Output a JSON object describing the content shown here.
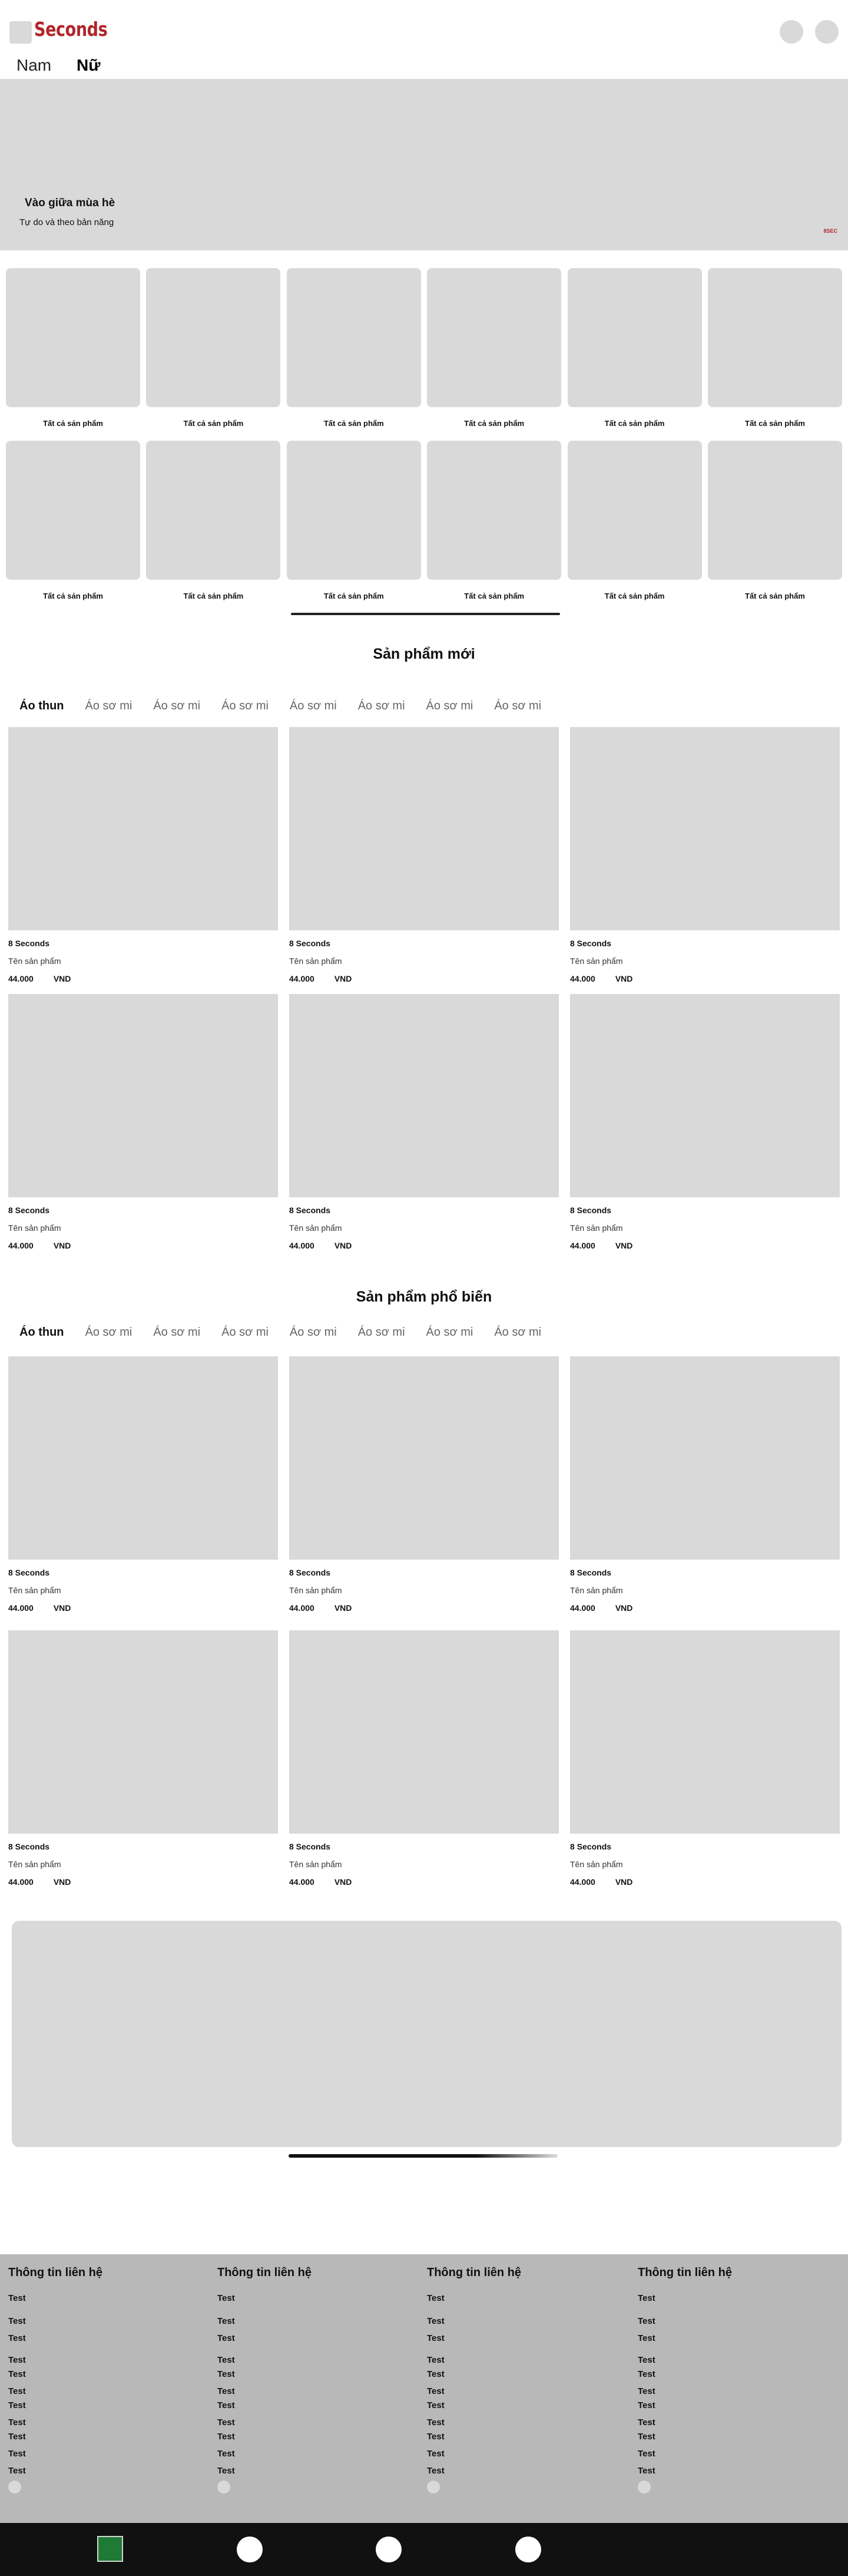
{
  "header": {
    "logo_text": "Seconds",
    "genders": [
      "Nam",
      "Nữ"
    ]
  },
  "hero": {
    "title": "Vào giữa mùa hè",
    "subtitle": "Tự do và theo bản năng",
    "brand_mark": "8SEC"
  },
  "categories": [
    "Tất cả sản phẩm",
    "Tất cả sản phẩm",
    "Tất cả sản phẩm",
    "Tất cả sản phẩm",
    "Tất cả sản phẩm",
    "Tất cả sản phẩm",
    "Tất cả sản phẩm",
    "Tất cả sản phẩm",
    "Tất cả sản phẩm",
    "Tất cả sản phẩm",
    "Tất cả sản phẩm",
    "Tất cả sản phẩm"
  ],
  "new_products": {
    "title": "Sản phẩm mới",
    "tabs": [
      "Áo thun",
      "Áo sơ mi",
      "Áo sơ mi",
      "Áo sơ mi",
      "Áo sơ mi",
      "Áo sơ mi",
      "Áo sơ mi",
      "Áo sơ mi"
    ],
    "products": [
      {
        "brand": "8 Seconds",
        "name": "Tên sản phẩm",
        "price": "44.000",
        "currency": "VND"
      },
      {
        "brand": "8 Seconds",
        "name": "Tên sản phẩm",
        "price": "44.000",
        "currency": "VND"
      },
      {
        "brand": "8 Seconds",
        "name": "Tên sản phẩm",
        "price": "44.000",
        "currency": "VND"
      },
      {
        "brand": "8 Seconds",
        "name": "Tên sản phẩm",
        "price": "44.000",
        "currency": "VND"
      },
      {
        "brand": "8 Seconds",
        "name": "Tên sản phẩm",
        "price": "44.000",
        "currency": "VND"
      },
      {
        "brand": "8 Seconds",
        "name": "Tên sản phẩm",
        "price": "44.000",
        "currency": "VND"
      }
    ]
  },
  "popular_products": {
    "title": "Sản phẩm phổ biến",
    "tabs": [
      "Áo thun",
      "Áo sơ mi",
      "Áo sơ mi",
      "Áo sơ mi",
      "Áo sơ mi",
      "Áo sơ mi",
      "Áo sơ mi",
      "Áo sơ mi"
    ],
    "products": [
      {
        "brand": "8 Seconds",
        "name": "Tên sản phẩm",
        "price": "44.000",
        "currency": "VND"
      },
      {
        "brand": "8 Seconds",
        "name": "Tên sản phẩm",
        "price": "44.000",
        "currency": "VND"
      },
      {
        "brand": "8 Seconds",
        "name": "Tên sản phẩm",
        "price": "44.000",
        "currency": "VND"
      },
      {
        "brand": "8 Seconds",
        "name": "Tên sản phẩm",
        "price": "44.000",
        "currency": "VND"
      },
      {
        "brand": "8 Seconds",
        "name": "Tên sản phẩm",
        "price": "44.000",
        "currency": "VND"
      },
      {
        "brand": "8 Seconds",
        "name": "Tên sản phẩm",
        "price": "44.000",
        "currency": "VND"
      }
    ]
  },
  "footer": {
    "columns": [
      {
        "title": "Thông tin liên hệ",
        "links": [
          "Test",
          "Test",
          "Test",
          "Test",
          "Test",
          "Test",
          "Test",
          "Test",
          "Test",
          "Test",
          "Test"
        ]
      },
      {
        "title": "Thông tin liên hệ",
        "links": [
          "Test",
          "Test",
          "Test",
          "Test",
          "Test",
          "Test",
          "Test",
          "Test",
          "Test",
          "Test",
          "Test"
        ]
      },
      {
        "title": "Thông tin liên hệ",
        "links": [
          "Test",
          "Test",
          "Test",
          "Test",
          "Test",
          "Test",
          "Test",
          "Test",
          "Test",
          "Test",
          "Test"
        ]
      },
      {
        "title": "Thông tin liên hệ",
        "links": [
          "Test",
          "Test",
          "Test",
          "Test",
          "Test",
          "Test",
          "Test",
          "Test",
          "Test",
          "Test",
          "Test"
        ]
      }
    ]
  },
  "colors": {
    "brand_red": "#b0262a",
    "placeholder_gray": "#d9d9d9",
    "footer_gray": "#b8b8b8",
    "bottom_bar": "#111111",
    "bottom_active": "#1f7a35"
  }
}
